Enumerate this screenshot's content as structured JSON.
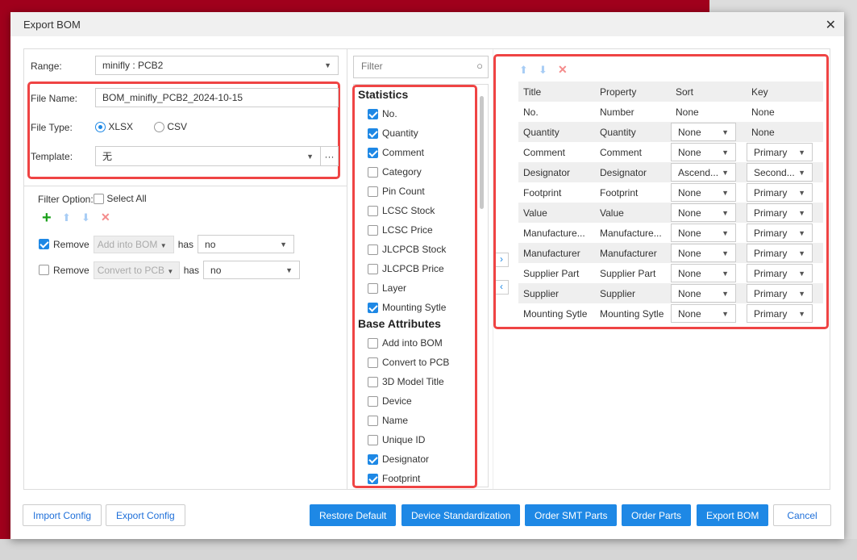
{
  "dialog": {
    "title": "Export BOM"
  },
  "left": {
    "range_label": "Range:",
    "range_value": "minifly : PCB2",
    "file_name_label": "File Name:",
    "file_name_value": "BOM_minifly_PCB2_2024-10-15",
    "file_type_label": "File Type:",
    "file_types": [
      {
        "label": "XLSX",
        "selected": true
      },
      {
        "label": "CSV",
        "selected": false
      }
    ],
    "template_label": "Template:",
    "template_value": "无",
    "template_more": "···",
    "filter_option_label": "Filter Option:",
    "select_all_label": "Select All",
    "filters": [
      {
        "checked": true,
        "action": "Remove",
        "field": "Add into BOM",
        "has": "has",
        "value": "no"
      },
      {
        "checked": false,
        "action": "Remove",
        "field": "Convert to PCB",
        "has": "has",
        "value": "no"
      }
    ]
  },
  "middle": {
    "filter_placeholder": "Filter",
    "sections": [
      {
        "title": "Statistics",
        "items": [
          {
            "label": "No.",
            "checked": true
          },
          {
            "label": "Quantity",
            "checked": true
          },
          {
            "label": "Comment",
            "checked": true
          },
          {
            "label": "Category",
            "checked": false
          },
          {
            "label": "Pin Count",
            "checked": false
          },
          {
            "label": "LCSC Stock",
            "checked": false
          },
          {
            "label": "LCSC Price",
            "checked": false
          },
          {
            "label": "JLCPCB Stock",
            "checked": false
          },
          {
            "label": "JLCPCB Price",
            "checked": false
          },
          {
            "label": "Layer",
            "checked": false
          },
          {
            "label": "Mounting Sytle",
            "checked": true
          }
        ]
      },
      {
        "title": "Base Attributes",
        "items": [
          {
            "label": "Add into BOM",
            "checked": false
          },
          {
            "label": "Convert to PCB",
            "checked": false
          },
          {
            "label": "3D Model Title",
            "checked": false
          },
          {
            "label": "Device",
            "checked": false
          },
          {
            "label": "Name",
            "checked": false
          },
          {
            "label": "Unique ID",
            "checked": false
          },
          {
            "label": "Designator",
            "checked": true
          },
          {
            "label": "Footprint",
            "checked": true
          }
        ]
      }
    ]
  },
  "right": {
    "headers": [
      "Title",
      "Property",
      "Sort",
      "Key"
    ],
    "rows": [
      {
        "title": "No.",
        "property": "Number",
        "sort": "None",
        "key": "None",
        "sort_select": false,
        "key_select": false
      },
      {
        "title": "Quantity",
        "property": "Quantity",
        "sort": "None",
        "key": "None",
        "sort_select": true,
        "key_select": false
      },
      {
        "title": "Comment",
        "property": "Comment",
        "sort": "None",
        "key": "Primary",
        "sort_select": true,
        "key_select": true
      },
      {
        "title": "Designator",
        "property": "Designator",
        "sort": "Ascend...",
        "key": "Second...",
        "sort_select": true,
        "key_select": true
      },
      {
        "title": "Footprint",
        "property": "Footprint",
        "sort": "None",
        "key": "Primary",
        "sort_select": true,
        "key_select": true
      },
      {
        "title": "Value",
        "property": "Value",
        "sort": "None",
        "key": "Primary",
        "sort_select": true,
        "key_select": true
      },
      {
        "title": "Manufacture...",
        "property": "Manufacture...",
        "sort": "None",
        "key": "Primary",
        "sort_select": true,
        "key_select": true
      },
      {
        "title": "Manufacturer",
        "property": "Manufacturer",
        "sort": "None",
        "key": "Primary",
        "sort_select": true,
        "key_select": true
      },
      {
        "title": "Supplier Part",
        "property": "Supplier Part",
        "sort": "None",
        "key": "Primary",
        "sort_select": true,
        "key_select": true
      },
      {
        "title": "Supplier",
        "property": "Supplier",
        "sort": "None",
        "key": "Primary",
        "sort_select": true,
        "key_select": true
      },
      {
        "title": "Mounting Sytle",
        "property": "Mounting Sytle",
        "sort": "None",
        "key": "Primary",
        "sort_select": true,
        "key_select": true
      }
    ]
  },
  "buttons": {
    "import_config": "Import Config",
    "export_config": "Export Config",
    "restore_default": "Restore Default",
    "device_standardization": "Device Standardization",
    "order_smt": "Order SMT Parts",
    "order_parts": "Order Parts",
    "export_bom": "Export BOM",
    "cancel": "Cancel"
  },
  "colors": {
    "accent": "#1e88e5",
    "highlight": "#ef4444"
  }
}
